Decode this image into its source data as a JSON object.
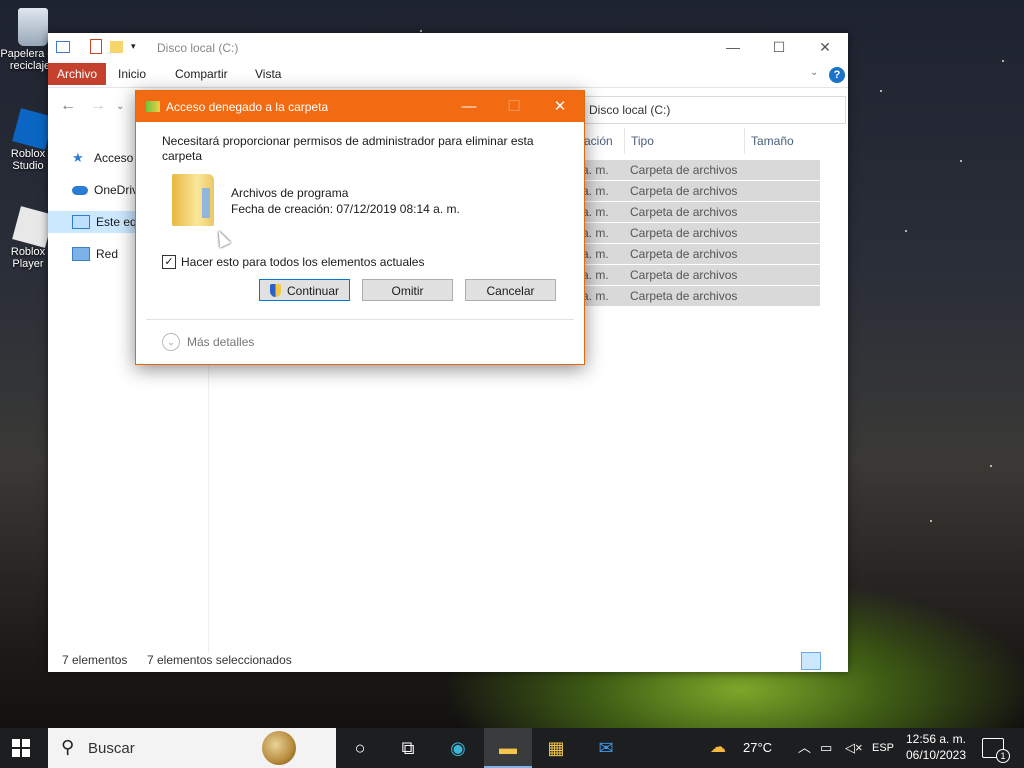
{
  "desktop": {
    "icons": [
      {
        "label": "Papelera de reciclaje"
      },
      {
        "label": "Roblox Studio"
      },
      {
        "label": "Roblox Player"
      }
    ]
  },
  "explorer": {
    "title": "Disco local (C:)",
    "tabs": [
      "Archivo",
      "Inicio",
      "Compartir",
      "Vista"
    ],
    "address": "Disco local (C:)",
    "address_prefix": "«",
    "sidebar": [
      {
        "label": "Acceso rápido"
      },
      {
        "label": "OneDrive"
      },
      {
        "label": "Este equipo"
      },
      {
        "label": "Red"
      }
    ],
    "columns": [
      "ación",
      "Tipo",
      "Tamaño"
    ],
    "rows": [
      {
        "date_frag": "a. m.",
        "type": "Carpeta de archivos"
      },
      {
        "date_frag": "a. m.",
        "type": "Carpeta de archivos"
      },
      {
        "date_frag": "a. m.",
        "type": "Carpeta de archivos"
      },
      {
        "date_frag": "a. m.",
        "type": "Carpeta de archivos"
      },
      {
        "date_frag": "a. m.",
        "type": "Carpeta de archivos"
      },
      {
        "date_frag": "a. m.",
        "type": "Carpeta de archivos"
      },
      {
        "date_frag": "a. m.",
        "type": "Carpeta de archivos"
      }
    ],
    "status_count": "7 elementos",
    "status_selected": "7 elementos seleccionados"
  },
  "dialog": {
    "title": "Acceso denegado a la carpeta",
    "message": "Necesitará proporcionar permisos de administrador para eliminar esta carpeta",
    "folder_name": "Archivos de programa",
    "folder_date": "Fecha de creación: 07/12/2019 08:14 a. m.",
    "checkbox_label": "Hacer esto para todos los elementos actuales",
    "checkbox_checked": true,
    "btn_continue": "Continuar",
    "btn_skip": "Omitir",
    "btn_cancel": "Cancelar",
    "more_details": "Más detalles"
  },
  "taskbar": {
    "search_placeholder": "Buscar",
    "weather": "27°C",
    "language": "ESP",
    "time": "12:56 a. m.",
    "date": "06/10/2023",
    "notification_count": "1"
  }
}
